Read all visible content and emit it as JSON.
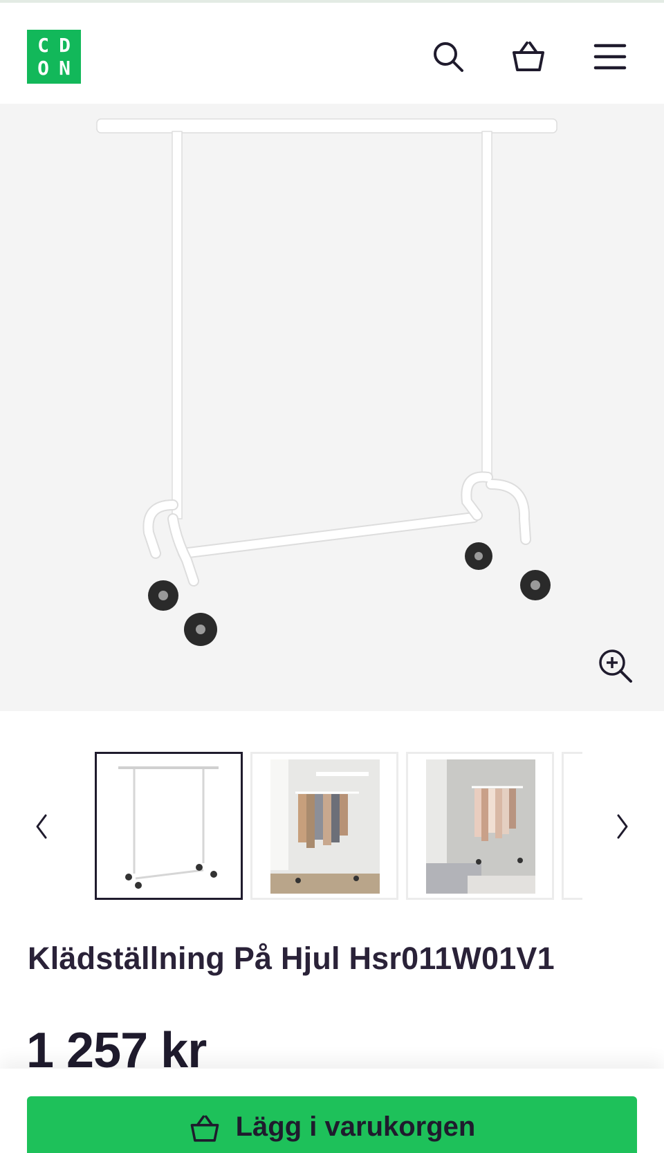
{
  "header": {
    "logo_letters": [
      "C",
      "D",
      "O",
      "N"
    ],
    "icons": [
      "search-icon",
      "basket-icon",
      "menu-icon"
    ]
  },
  "product": {
    "title": "Klädställning På Hjul Hsr011W01V1",
    "price": "1 257 kr"
  },
  "gallery": {
    "thumbnail_count_visible": 4,
    "active_index": 0
  },
  "actions": {
    "add_to_cart_label": "Lägg i varukorgen"
  },
  "colors": {
    "brand_green": "#12b85a",
    "button_green": "#1ec15a",
    "text_dark": "#1f1b2d"
  }
}
